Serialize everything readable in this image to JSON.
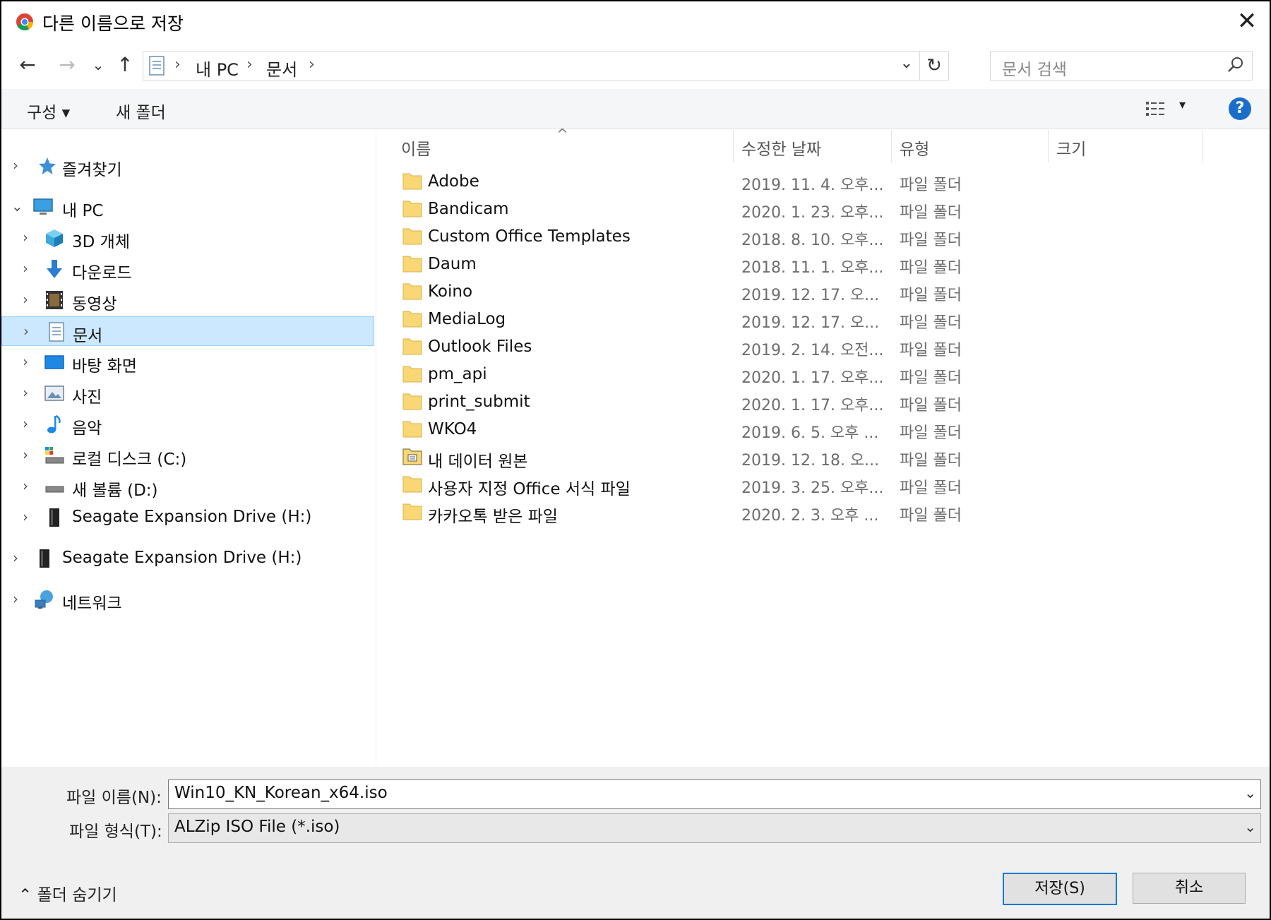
{
  "window": {
    "title": "다른 이름으로 저장",
    "close_label": "✕"
  },
  "nav": {
    "back": "←",
    "forward": "→",
    "recent": "⌄",
    "up": "↑",
    "breadcrumb": [
      "내 PC",
      "문서"
    ],
    "separator": "›",
    "dropdown": "⌄",
    "refresh": "↻",
    "search_placeholder": "문서 검색"
  },
  "toolbar": {
    "organize_label": "구성 ▾",
    "new_folder_label": "새 폴더",
    "view_dropdown": "▾",
    "help_label": "?"
  },
  "sidebar": {
    "items": [
      {
        "label": "즐겨찾기",
        "icon": "star-icon"
      },
      {
        "label": "내 PC",
        "icon": "pc-icon"
      },
      {
        "label": "3D 개체",
        "icon": "cube-icon"
      },
      {
        "label": "다운로드",
        "icon": "download-icon"
      },
      {
        "label": "동영상",
        "icon": "video-icon"
      },
      {
        "label": "문서",
        "icon": "document-icon"
      },
      {
        "label": "바탕 화면",
        "icon": "desktop-icon"
      },
      {
        "label": "사진",
        "icon": "picture-icon"
      },
      {
        "label": "음악",
        "icon": "music-icon"
      },
      {
        "label": "로컬 디스크 (C:)",
        "icon": "local-disk-icon"
      },
      {
        "label": "새 볼륨 (D:)",
        "icon": "drive-icon"
      },
      {
        "label": "Seagate Expansion Drive (H:)",
        "icon": "external-drive-icon"
      },
      {
        "label": "Seagate Expansion Drive (H:)",
        "icon": "external-drive-icon"
      },
      {
        "label": "네트워크",
        "icon": "network-icon"
      }
    ]
  },
  "columns": {
    "name": "이름",
    "date": "수정한 날짜",
    "type": "유형",
    "size": "크기",
    "sort_indicator": "^"
  },
  "files": [
    {
      "name": "Adobe",
      "date": "2019. 11. 4. 오후...",
      "type": "파일 폴더"
    },
    {
      "name": "Bandicam",
      "date": "2020. 1. 23. 오후...",
      "type": "파일 폴더"
    },
    {
      "name": "Custom Office Templates",
      "date": "2018. 8. 10. 오후...",
      "type": "파일 폴더"
    },
    {
      "name": "Daum",
      "date": "2018. 11. 1. 오후...",
      "type": "파일 폴더"
    },
    {
      "name": "Koino",
      "date": "2019. 12. 17. 오...",
      "type": "파일 폴더"
    },
    {
      "name": "MediaLog",
      "date": "2019. 12. 17. 오...",
      "type": "파일 폴더"
    },
    {
      "name": "Outlook Files",
      "date": "2019. 2. 14. 오전...",
      "type": "파일 폴더"
    },
    {
      "name": "pm_api",
      "date": "2020. 1. 17. 오후...",
      "type": "파일 폴더"
    },
    {
      "name": "print_submit",
      "date": "2020. 1. 17. 오후...",
      "type": "파일 폴더"
    },
    {
      "name": "WKO4",
      "date": "2019. 6. 5. 오후 ...",
      "type": "파일 폴더"
    },
    {
      "name": "내 데이터 원본",
      "date": "2019. 12. 18. 오...",
      "type": "파일 폴더"
    },
    {
      "name": "사용자 지정 Office 서식 파일",
      "date": "2019. 3. 25. 오후...",
      "type": "파일 폴더"
    },
    {
      "name": "카카오톡 받은 파일",
      "date": "2020. 2. 3. 오후 ...",
      "type": "파일 폴더"
    }
  ],
  "save": {
    "filename_label": "파일 이름(N):",
    "filename_value": "Win10_KN_Korean_x64.iso",
    "filetype_label": "파일 형식(T):",
    "filetype_value": "ALZip ISO File (*.iso)",
    "hide_folders_label": "⌃  폴더 숨기기",
    "save_button": "저장(S)",
    "cancel_button": "취소",
    "dropdown": "⌄"
  },
  "colors": {
    "selection": "#cce8ff",
    "folder": "#f8d775",
    "accent": "#0078d7"
  }
}
